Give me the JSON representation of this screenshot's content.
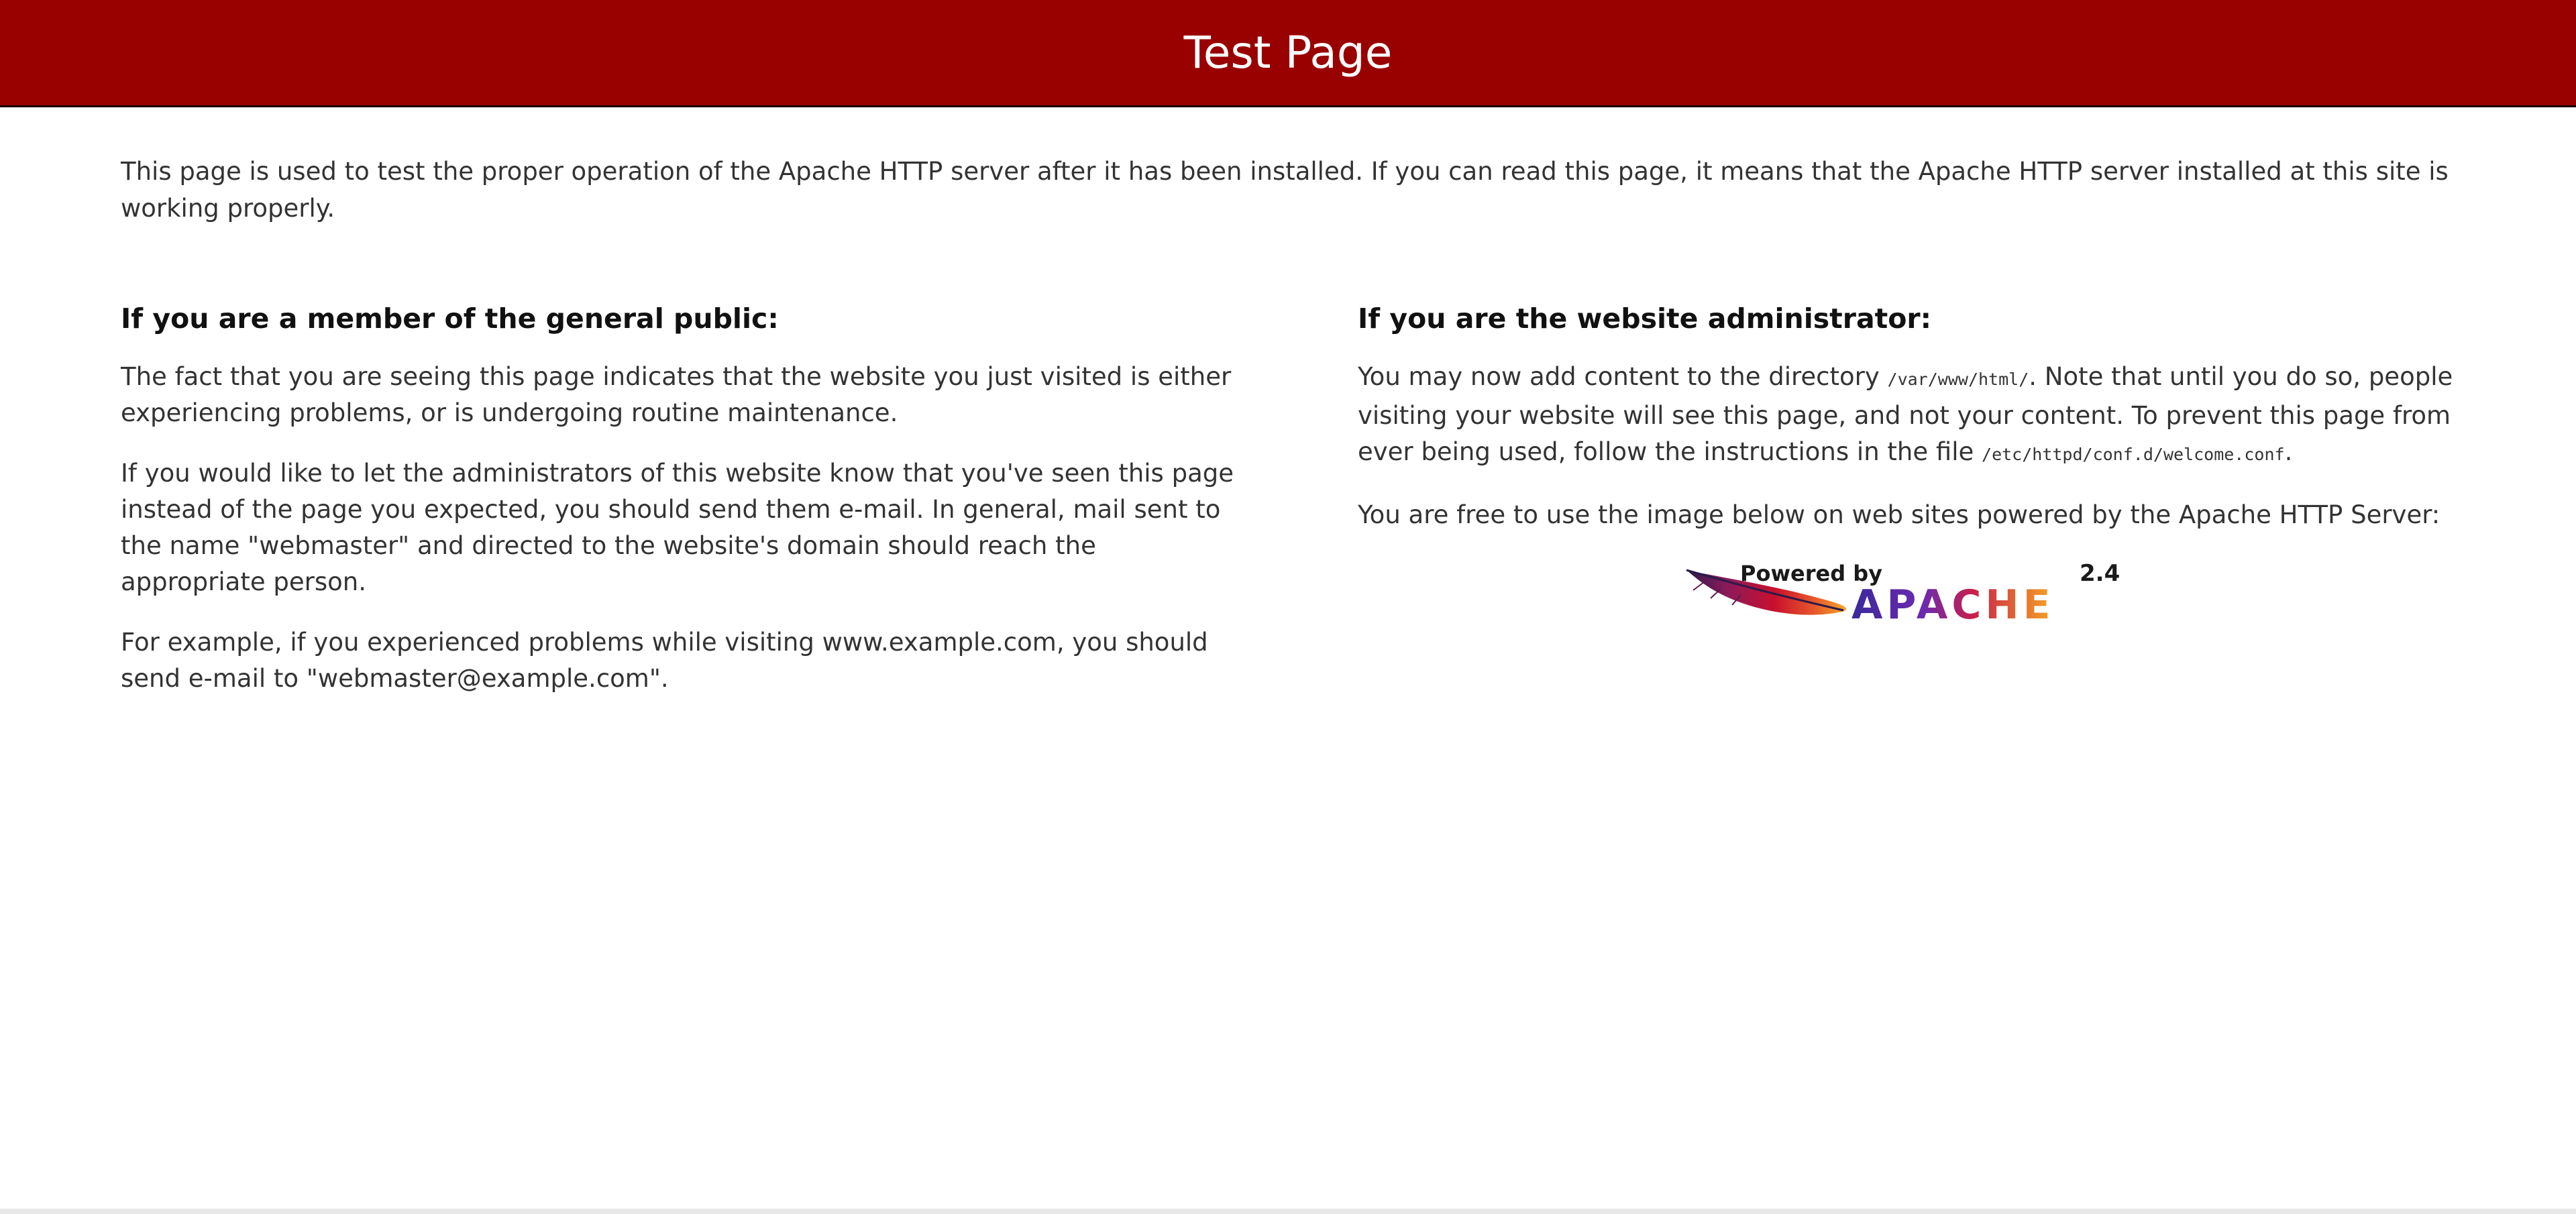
{
  "header": {
    "title": "Test Page"
  },
  "intro": "This page is used to test the proper operation of the Apache HTTP server after it has been installed. If you can read this page, it means that the Apache HTTP server installed at this site is working properly.",
  "public_section": {
    "heading": "If you are a member of the general public:",
    "paragraphs": [
      "The fact that you are seeing this page indicates that the website you just visited is either experiencing problems, or is undergoing routine maintenance.",
      "If you would like to let the administrators of this website know that you've seen this page instead of the page you expected, you should send them e-mail. In general, mail sent to the name \"webmaster\" and directed to the website's domain should reach the appropriate person.",
      "For example, if you experienced problems while visiting www.example.com, you should send e-mail to \"webmaster@example.com\"."
    ]
  },
  "admin_section": {
    "heading": "If you are the website administrator:",
    "p1_before": "You may now add content to the directory ",
    "p1_dir": "/var/www/html/",
    "p1_middle": ". Note that until you do so, people visiting your website will see this page, and not your content. To prevent this page from ever being used, follow the instructions in the file ",
    "p1_file": "/etc/httpd/conf.d/welcome.conf",
    "p1_after": ".",
    "p2": "You are free to use the image below on web sites powered by the Apache HTTP Server:"
  },
  "logo": {
    "powered_by": "Powered by",
    "brand": "APACHE",
    "version": "2.4"
  },
  "colors": {
    "header_bg": "#990000",
    "text": "#333333"
  }
}
